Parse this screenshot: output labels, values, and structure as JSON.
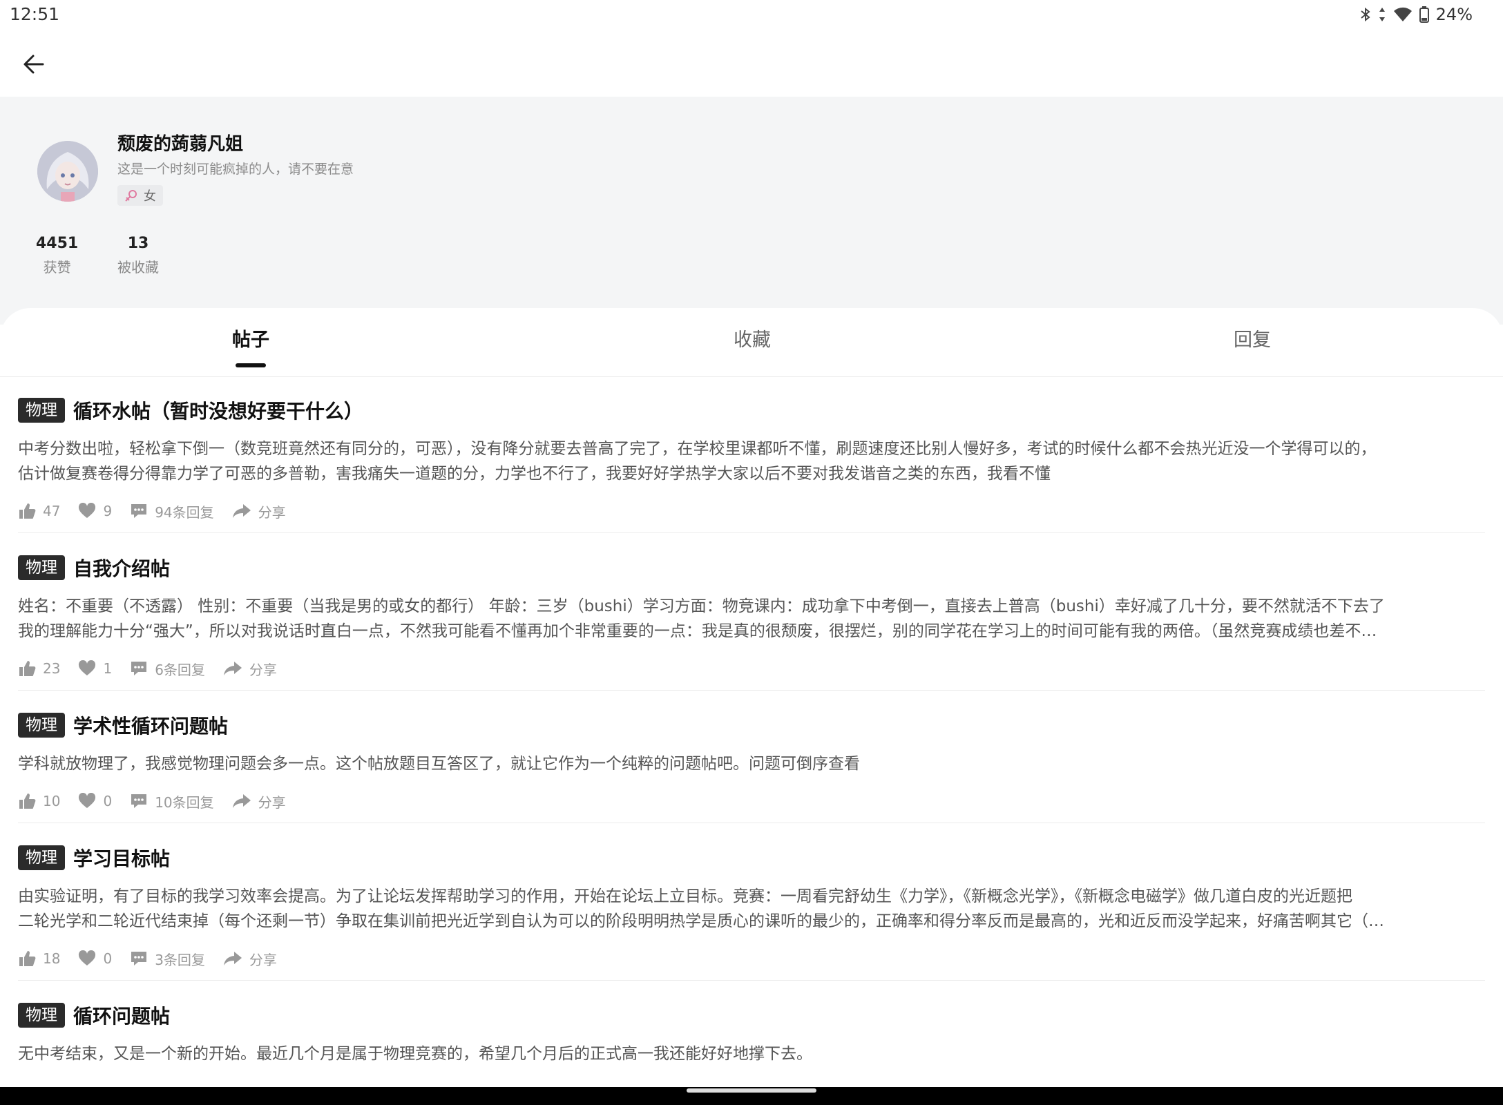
{
  "status": {
    "time": "12:51",
    "battery": "24%"
  },
  "profile": {
    "name": "颓废的蒟蒻凡姐",
    "bio": "这是一个时刻可能疯掉的人，请不要在意",
    "gender": "女",
    "likes_num": "4451",
    "likes_label": "获赞",
    "fav_num": "13",
    "fav_label": "被收藏"
  },
  "tabs": [
    {
      "label": "帖子"
    },
    {
      "label": "收藏"
    },
    {
      "label": "回复"
    }
  ],
  "posts": [
    {
      "tag": "物理",
      "title": "循环水帖（暂时没想好要干什么）",
      "line1": "中考分数出啦，轻松拿下倒一（数竞班竟然还有同分的，可恶），没有降分就要去普高了完了，在学校里课都听不懂，刷题速度还比别人慢好多，考试的时候什么都不会热光近没一个学得可以的，",
      "line2": "估计做复赛卷得分得靠力学了可恶的多普勒，害我痛失一道题的分，力学也不行了，我要好好学热学大家以后不要对我发谐音之类的东西，我看不懂",
      "likes": "47",
      "hearts": "9",
      "replies": "94条回复",
      "share": "分享"
    },
    {
      "tag": "物理",
      "title": "自我介绍帖",
      "line1": "姓名：不重要（不透露） 性别：不重要（当我是男的或女的都行） 年龄：三岁（bushi）学习方面：物竞课内：成功拿下中考倒一，直接去上普高（bushi）幸好减了几十分，要不然就活不下去了",
      "line2": "我的理解能力十分“强大”，所以对我说话时直白一点，不然我可能看不懂再加个非常重要的一点：我是真的很颓废，很摆烂，别的同学花在学习上的时间可能有我的两倍。（虽然竞赛成绩也差不…",
      "likes": "23",
      "hearts": "1",
      "replies": "6条回复",
      "share": "分享"
    },
    {
      "tag": "物理",
      "title": "学术性循环问题帖",
      "line1": "学科就放物理了，我感觉物理问题会多一点。这个帖放题目互答区了，就让它作为一个纯粹的问题帖吧。问题可倒序查看",
      "line2": "",
      "likes": "10",
      "hearts": "0",
      "replies": "10条回复",
      "share": "分享"
    },
    {
      "tag": "物理",
      "title": "学习目标帖",
      "line1": "由实验证明，有了目标的我学习效率会提高。为了让论坛发挥帮助学习的作用，开始在论坛上立目标。竞赛：一周看完舒幼生《力学》，《新概念光学》，《新概念电磁学》做几道白皮的光近题把",
      "line2": "二轮光学和二轮近代结束掉（每个还剩一节）争取在集训前把光近学到自认为可以的阶段明明热学是质心的课听的最少的，正确率和得分率反而是最高的，光和近反而没学起来，好痛苦啊其它（…",
      "likes": "18",
      "hearts": "0",
      "replies": "3条回复",
      "share": "分享"
    },
    {
      "tag": "物理",
      "title": "循环问题帖",
      "line1": "无中考结束，又是一个新的开始。最近几个月是属于物理竞赛的，希望几个月后的正式高一我还能好好地撑下去。",
      "line2": ""
    }
  ]
}
